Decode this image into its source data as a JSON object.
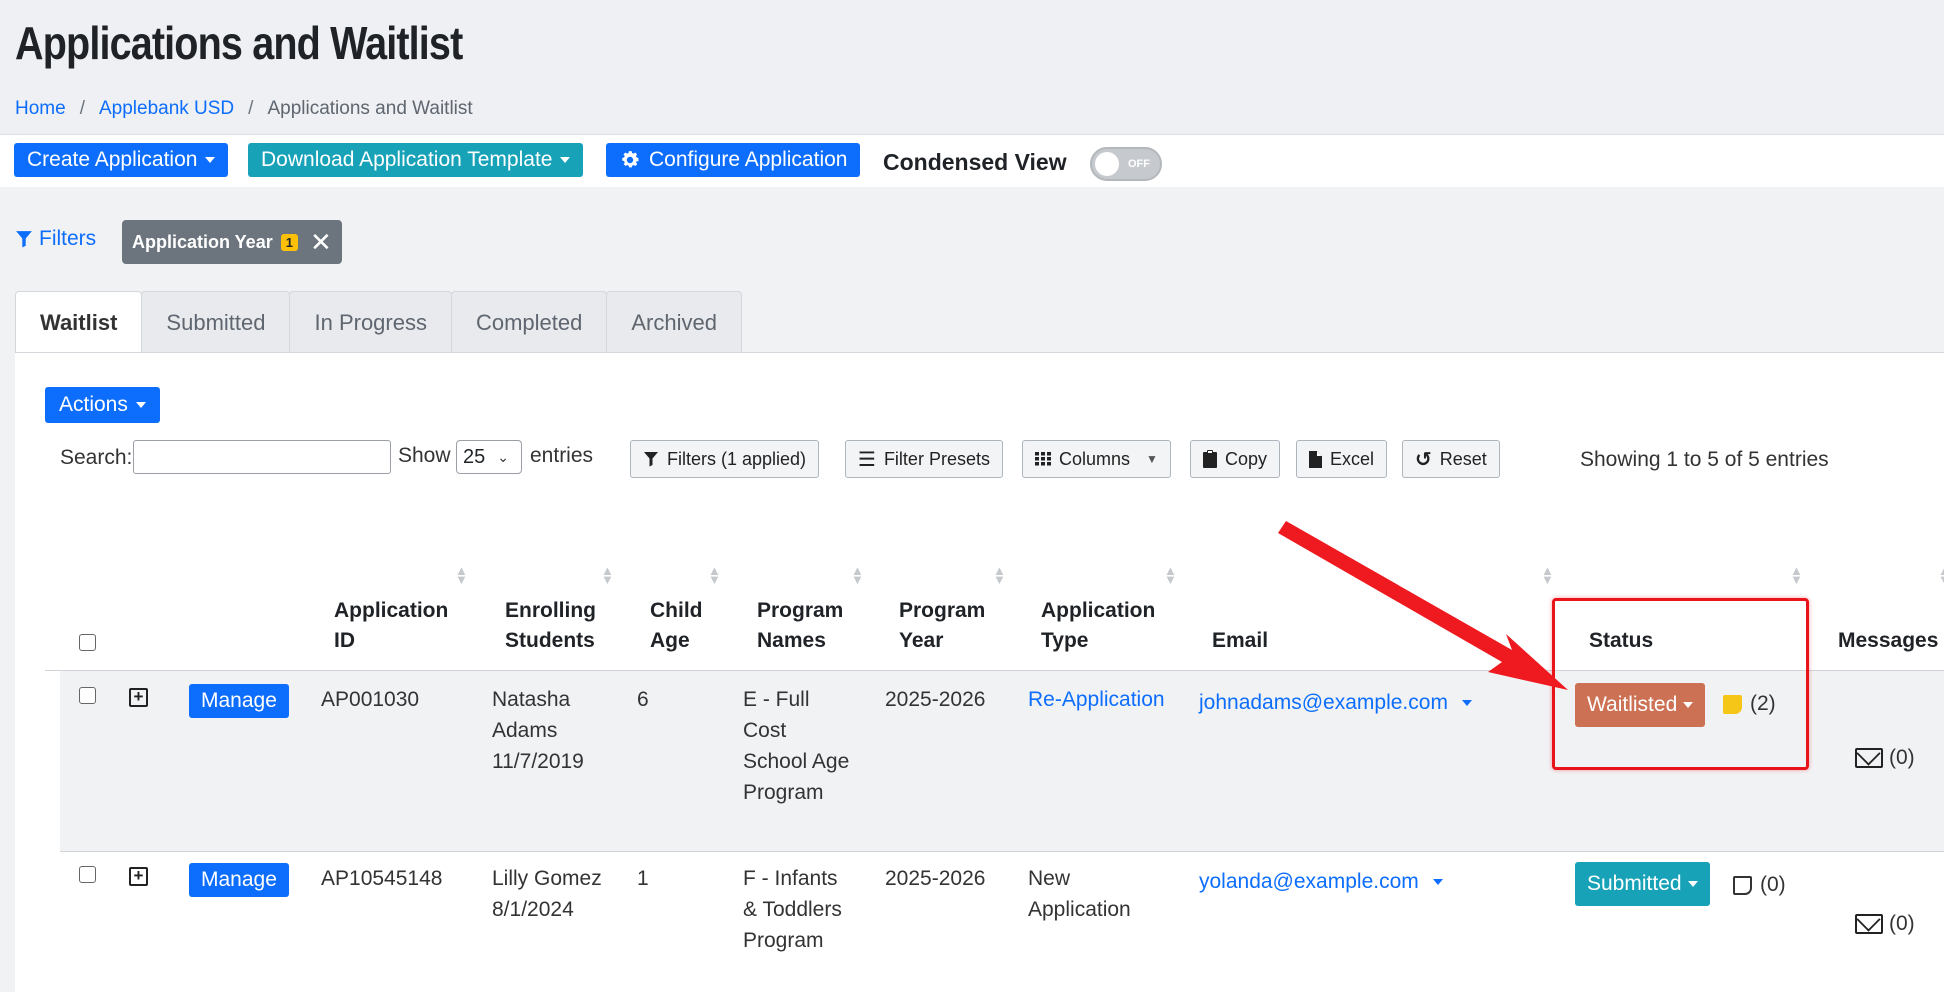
{
  "page": {
    "title": "Applications and Waitlist",
    "breadcrumb": [
      "Home",
      "Applebank USD",
      "Applications and Waitlist"
    ]
  },
  "toolbar": {
    "create_label": "Create Application",
    "download_label": "Download Application Template",
    "configure_label": "Configure Application",
    "condensed_label": "Condensed View",
    "toggle_state": "OFF"
  },
  "filters": {
    "link_label": "Filters",
    "chip_label": "Application Year",
    "chip_count": "1"
  },
  "tabs": [
    "Waitlist",
    "Submitted",
    "In Progress",
    "Completed",
    "Archived"
  ],
  "table_controls": {
    "actions_label": "Actions",
    "search_label": "Search:",
    "show_label": "Show",
    "page_size": "25",
    "entries_label": "entries",
    "filters_applied": "Filters (1 applied)",
    "filter_presets": "Filter Presets",
    "columns": "Columns",
    "copy": "Copy",
    "excel": "Excel",
    "reset": "Reset",
    "showing": "Showing 1 to 5 of 5 entries"
  },
  "columns": {
    "app_id": [
      "Application",
      "ID"
    ],
    "enrolling": [
      "Enrolling",
      "Students"
    ],
    "child_age": [
      "Child",
      "Age"
    ],
    "program_names": [
      "Program",
      "Names"
    ],
    "program_year": [
      "Program",
      "Year"
    ],
    "app_type": [
      "Application",
      "Type"
    ],
    "email": "Email",
    "status": "Status",
    "messages": "Messages"
  },
  "rows": [
    {
      "manage": "Manage",
      "app_id": "AP001030",
      "student": [
        "Natasha",
        "Adams",
        "11/7/2019"
      ],
      "age": "6",
      "program": [
        "E - Full",
        "Cost",
        "School Age",
        "Program"
      ],
      "year": "2025-2026",
      "type": [
        "Re-Application"
      ],
      "email": "johnadams@example.com",
      "status": "Waitlisted",
      "status_color": "#cd7155",
      "notes": "(2)",
      "messages": "(0)"
    },
    {
      "manage": "Manage",
      "app_id": "AP10545148",
      "student": [
        "Lilly Gomez",
        "8/1/2024"
      ],
      "age": "1",
      "program": [
        "F - Infants",
        "& Toddlers",
        "Program"
      ],
      "year": "2025-2026",
      "type": [
        "New",
        "Application"
      ],
      "email": "yolanda@example.com",
      "status": "Submitted",
      "status_color": "#17a2b8",
      "notes": "(0)",
      "messages": "(0)"
    }
  ],
  "icons": [
    "gear-icon",
    "filter-icon",
    "close-icon",
    "list-icon",
    "grid-icon",
    "clipboard-icon",
    "file-icon",
    "reset-icon",
    "note-icon",
    "envelope-icon",
    "sort-icon",
    "plus-square-icon"
  ],
  "colors": {
    "primary": "#0d6efd",
    "teal": "#17a2b8",
    "waitlisted": "#cd7155",
    "highlight": "#e8141a"
  }
}
